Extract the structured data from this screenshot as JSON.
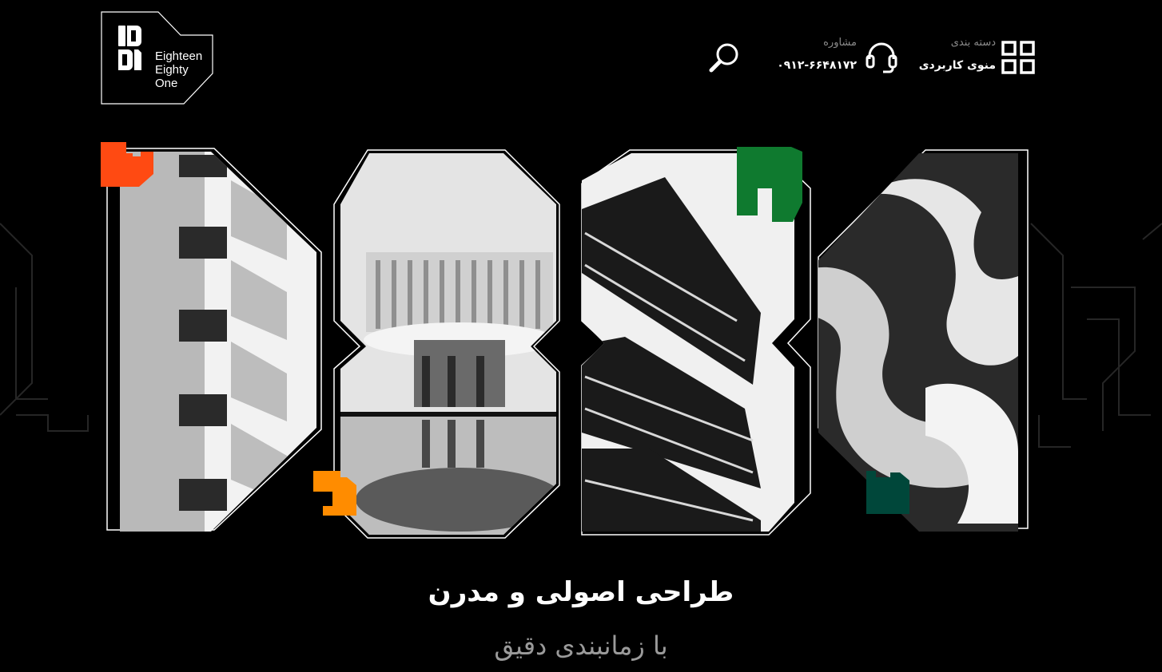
{
  "logo": {
    "line1": "Eighteen",
    "line2": "Eighty",
    "line3": "One",
    "icon": "1881-monogram-icon"
  },
  "header": {
    "search_icon": "search-icon",
    "consult": {
      "label": "مشاوره",
      "phone": "۰۹۱۲-۶۶۴۸۱۷۲",
      "icon": "headset-icon"
    },
    "menu": {
      "label": "دسته بندی",
      "title": "منوی کاربردی",
      "icon": "grid-icon"
    }
  },
  "hero": {
    "title": "طراحی اصولی و مدرن",
    "subtitle": "با زمانبندی دقیق"
  },
  "colors": {
    "background": "#000000",
    "accent_red": "#ff4a12",
    "accent_orange": "#ff8c00",
    "accent_green": "#0f7a2f",
    "accent_dark_green": "#00473a",
    "muted_text": "#9a9a9a"
  }
}
